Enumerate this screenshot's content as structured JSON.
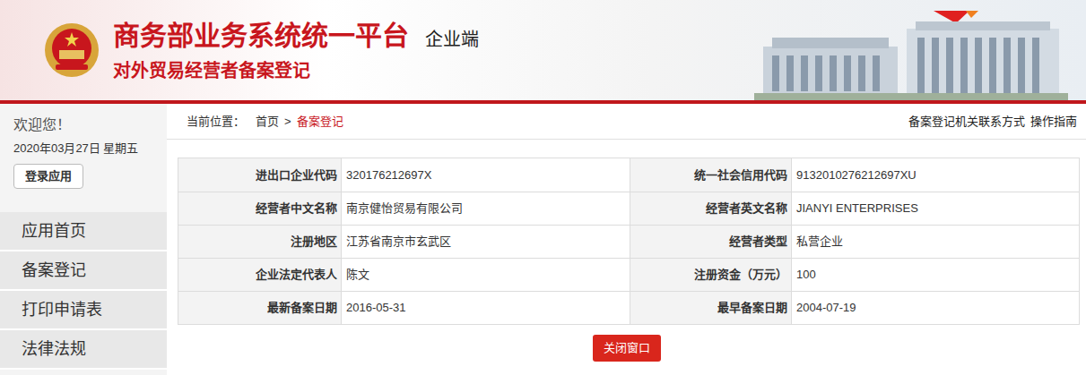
{
  "header": {
    "title": "商务部业务系统统一平台",
    "badge": "企业端",
    "subtitle": "对外贸易经营者备案登记"
  },
  "sidebar": {
    "welcome": "欢迎您！",
    "date": "2020年03月27日 星期五",
    "login_button": "登录应用",
    "items": [
      {
        "label": "应用首页",
        "selected": false
      },
      {
        "label": "备案登记",
        "selected": false
      },
      {
        "label": "打印申请表",
        "selected": false
      },
      {
        "label": "法律法规",
        "selected": false
      }
    ]
  },
  "breadcrumb": {
    "label": "当前位置：",
    "separator": ">",
    "items": [
      {
        "label": "首页",
        "selected": false
      },
      {
        "label": "备案登记",
        "selected": true
      }
    ]
  },
  "links": [
    "备案登记机关联系方式",
    "操作指南"
  ],
  "table": {
    "rows": [
      [
        {
          "label": "进出口企业代码",
          "value": "320176212697X"
        },
        {
          "label": "统一社会信用代码",
          "value": "913201027621269​7XU"
        }
      ],
      [
        {
          "label": "经营者中文名称",
          "value": "南京健怡贸易有限公司"
        },
        {
          "label": "经营者英文名称",
          "value": "JIANYI ENTERPRISES"
        }
      ],
      [
        {
          "label": "注册地区",
          "value": "江苏省南京市玄武区"
        },
        {
          "label": "经营者类型",
          "value": "私营企业"
        }
      ],
      [
        {
          "label": "企业法定代表人",
          "value": "陈文"
        },
        {
          "label": "注册资金（万元）",
          "value": "100"
        }
      ],
      [
        {
          "label": "最新备案日期",
          "value": "2016-05-31"
        },
        {
          "label": "最早备案日期",
          "value": "2004-07-19"
        }
      ]
    ]
  },
  "close_button": "关闭窗口"
}
